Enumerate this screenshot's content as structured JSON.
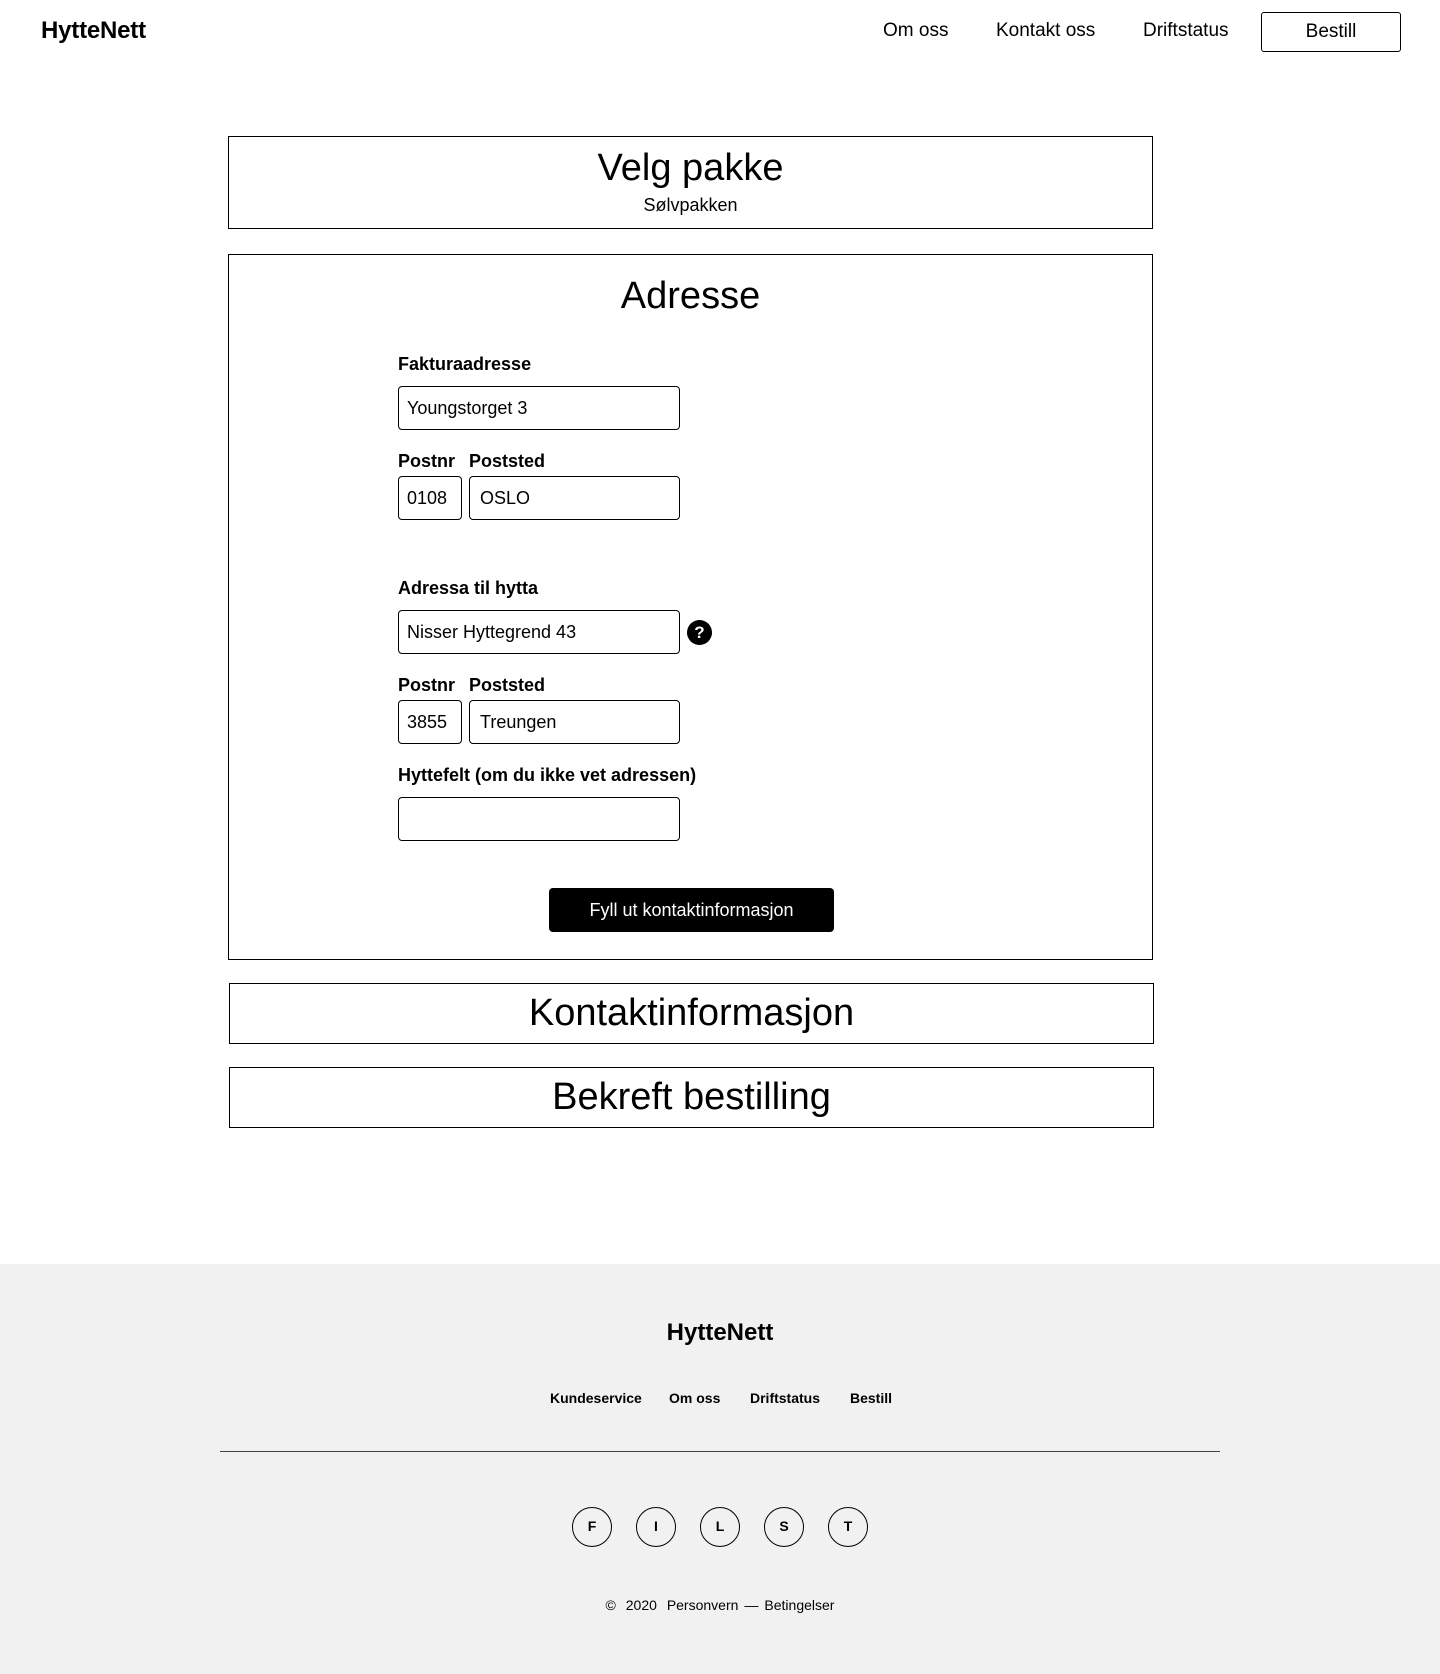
{
  "header": {
    "logo": "HytteNett",
    "nav": {
      "om_oss": "Om oss",
      "kontakt_oss": "Kontakt oss",
      "driftstatus": "Driftstatus",
      "bestill": "Bestill"
    }
  },
  "steps": {
    "velg_pakke": {
      "title": "Velg pakke",
      "selected": "Sølvpakken"
    },
    "adresse": {
      "title": "Adresse",
      "faktura": {
        "label": "Fakturaadresse",
        "value": "Youngstorget 3",
        "postnr_label": "Postnr",
        "poststed_label": "Poststed",
        "postnr": "0108",
        "poststed": "OSLO"
      },
      "hytte": {
        "label": "Adressa til hytta",
        "value": "Nisser Hyttegrend 43",
        "help_icon": "?",
        "postnr_label": "Postnr",
        "poststed_label": "Poststed",
        "postnr": "3855",
        "poststed": "Treungen"
      },
      "hyttefelt": {
        "label": "Hyttefelt (om du ikke vet adressen)",
        "value": ""
      },
      "submit": "Fyll ut kontaktinformasjon"
    },
    "kontaktinformasjon": {
      "title": "Kontaktinformasjon"
    },
    "bekreft": {
      "title": "Bekreft bestilling"
    }
  },
  "footer": {
    "logo": "HytteNett",
    "links": [
      "Kundeservice",
      "Om oss",
      "Driftstatus",
      "Bestill"
    ],
    "social": [
      "F",
      "I",
      "L",
      "S",
      "T"
    ],
    "copyright_symbol": "©",
    "year": "2020",
    "personvern": "Personvern",
    "separator": "—",
    "betingelser": "Betingelser"
  },
  "colors": {
    "text": "#000000",
    "background": "#ffffff",
    "footer_bg": "#f1f1f1",
    "button_bg": "#000000",
    "button_text": "#ffffff"
  }
}
